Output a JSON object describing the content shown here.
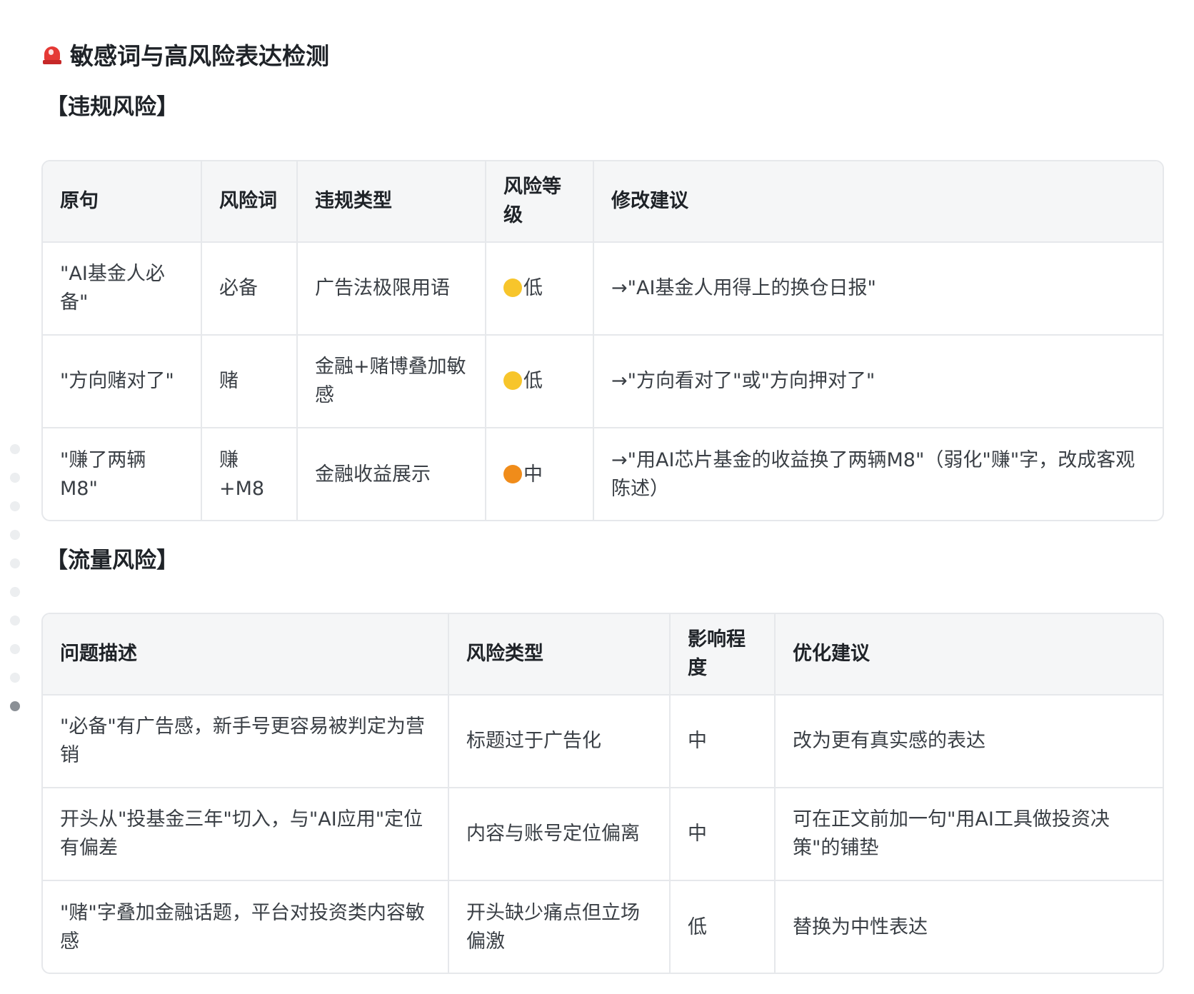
{
  "heading": {
    "icon": "siren-icon",
    "title": "敏感词与高风险表达检测"
  },
  "nav_dots": {
    "count": 10,
    "active_index": 9
  },
  "violation": {
    "title": "【违规风险】",
    "columns": [
      "原句",
      "风险词",
      "违规类型",
      "风险等级",
      "修改建议"
    ],
    "rows": [
      {
        "original": "\"AI基金人必备\"",
        "risk_word": "必备",
        "type": "广告法极限用语",
        "level": "低",
        "level_color": "#f7c52b",
        "suggestion": "→\"AI基金人用得上的换仓日报\""
      },
      {
        "original": "\"方向赌对了\"",
        "risk_word": "赌",
        "type": "金融+赌博叠加敏感",
        "level": "低",
        "level_color": "#f7c52b",
        "suggestion": "→\"方向看对了\"或\"方向押对了\""
      },
      {
        "original": "\"赚了两辆M8\"",
        "risk_word": "赚+M8",
        "type": "金融收益展示",
        "level": "中",
        "level_color": "#f08c1a",
        "suggestion": "→\"用AI芯片基金的收益换了两辆M8\"（弱化\"赚\"字，改成客观陈述）"
      }
    ]
  },
  "traffic": {
    "title": "【流量风险】",
    "columns": [
      "问题描述",
      "风险类型",
      "影响程度",
      "优化建议"
    ],
    "rows": [
      {
        "description": "\"必备\"有广告感，新手号更容易被判定为营销",
        "type": "标题过于广告化",
        "impact": "中",
        "suggestion": "改为更有真实感的表达"
      },
      {
        "description": "开头从\"投基金三年\"切入，与\"AI应用\"定位有偏差",
        "type": "内容与账号定位偏离",
        "impact": "中",
        "suggestion": "可在正文前加一句\"用AI工具做投资决策\"的铺垫"
      },
      {
        "description": "\"赌\"字叠加金融话题，平台对投资类内容敏感",
        "type": "开头缺少痛点但立场偏激",
        "impact": "低",
        "suggestion": "替换为中性表达"
      }
    ]
  }
}
